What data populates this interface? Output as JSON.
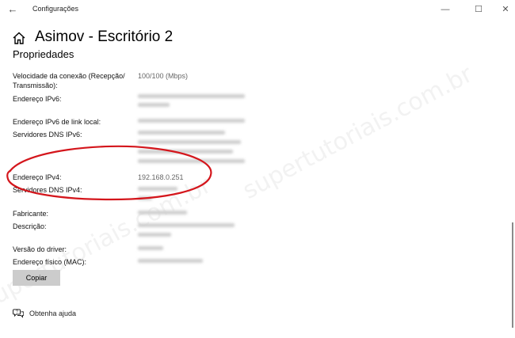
{
  "window": {
    "app_title": "Configurações",
    "back_icon": "back-arrow-icon",
    "controls": {
      "minimize": "—",
      "maximize": "☐",
      "close": "✕"
    }
  },
  "header": {
    "title": "Asimov - Escritório 2",
    "home_icon": "home-icon"
  },
  "section_title": "Propriedades",
  "properties": [
    {
      "label": "Velocidade da conexão (Recepção/ Transmissão):",
      "value": "100/100 (Mbps)"
    },
    {
      "label": "Endereço IPv6:",
      "value": ""
    },
    {
      "label": "Endereço IPv6 de link local:",
      "value": ""
    },
    {
      "label": "Servidores DNS IPv6:",
      "value": ""
    },
    {
      "label": "Endereço IPv4:",
      "value": "192.168.0.251"
    },
    {
      "label": "Servidores DNS IPv4:",
      "value": ""
    },
    {
      "label": "Fabricante:",
      "value": ""
    },
    {
      "label": "Descrição:",
      "value": ""
    },
    {
      "label": "Versão do driver:",
      "value": ""
    },
    {
      "label": "Endereço físico (MAC):",
      "value": ""
    }
  ],
  "copy_button": "Copiar",
  "help": {
    "icon": "chat-help-icon",
    "label": "Obtenha ajuda"
  },
  "watermark": "supertutoriais.com.br",
  "colors": {
    "annotation": "#d4161c",
    "button_bg": "#cccccc",
    "value_text": "#666666"
  }
}
